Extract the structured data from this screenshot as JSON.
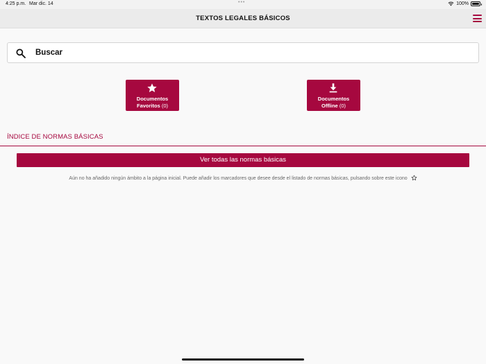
{
  "status_bar": {
    "time": "4:25 p.m.",
    "date": "Mar dic. 14",
    "dots": "•••",
    "battery": "100%"
  },
  "header": {
    "title": "TEXTOS LEGALES BÁSICOS",
    "menu_icon": "hamburger-icon"
  },
  "search": {
    "placeholder": "Buscar",
    "value": "",
    "icon": "search-icon"
  },
  "tiles": [
    {
      "icon": "star-icon",
      "line1": "Documentos",
      "line2": "Favoritos",
      "count": "(0)"
    },
    {
      "icon": "download-icon",
      "line1": "Documentos",
      "line2": "Offline",
      "count": "(0)"
    }
  ],
  "section": {
    "title": "ÍNDICE DE NORMAS BÁSICAS",
    "button_label": "Ver todas las normas básicas",
    "empty_message": "Aún no ha añadido ningún ámbito a la página inicial. Puede añadir los marcadores que desee desde el listado de normas básicas, pulsando sobre este icono"
  },
  "colors": {
    "accent": "#a6083f",
    "background": "#f9f9f9",
    "header_background": "#ebebeb"
  }
}
